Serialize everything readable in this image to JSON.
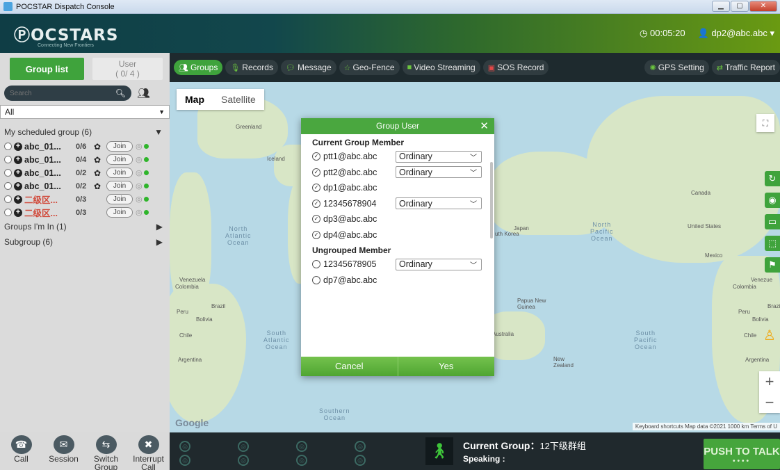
{
  "window": {
    "title": "POCSTAR Dispatch Console"
  },
  "header": {
    "logo_text": "ⓅOCSTARS",
    "logo_tagline": "Connecting New Frontiers",
    "timer": "00:05:20",
    "user": "dp2@abc.abc"
  },
  "sidebar": {
    "tab_group_list": "Group list",
    "tab_user_label": "User",
    "tab_user_count": "( 0/ 4 )",
    "search_placeholder": "Search",
    "filter_value": "All",
    "scheduled_label": "My scheduled group (6)",
    "groups": [
      {
        "name": "abc_01...",
        "count": "0/6",
        "join": "Join",
        "gear": true,
        "red": false
      },
      {
        "name": "abc_01...",
        "count": "0/4",
        "join": "Join",
        "gear": true,
        "red": false
      },
      {
        "name": "abc_01...",
        "count": "0/2",
        "join": "Join",
        "gear": true,
        "red": false
      },
      {
        "name": "abc_01...",
        "count": "0/2",
        "join": "Join",
        "gear": true,
        "red": false
      },
      {
        "name": "二级区...",
        "count": "0/3",
        "join": "Join",
        "gear": false,
        "red": true
      },
      {
        "name": "二级区...",
        "count": "0/3",
        "join": "Join",
        "gear": false,
        "red": true
      }
    ],
    "groups_in_label": "Groups I'm In (1)",
    "subgroup_label": "Subgroup (6)"
  },
  "toolbar": {
    "groups": "Groups",
    "records": "Records",
    "message": "Message",
    "geofence": "Geo-Fence",
    "video": "Video Streaming",
    "sos": "SOS Record",
    "gps": "GPS Setting",
    "traffic": "Traffic Report"
  },
  "map": {
    "type_map": "Map",
    "type_satellite": "Satellite",
    "google": "Google",
    "footer": "Keyboard shortcuts  Map data ©2021  1000 km  Terms of U",
    "labels": {
      "greenland": "Greenland",
      "iceland": "Iceland",
      "north_atlantic": "North\nAtlantic\nOcean",
      "south_atlantic": "South\nAtlantic\nOcean",
      "north_pacific": "North\nPacific\nOcean",
      "south_pacific": "South\nPacific\nOcean",
      "southern_ocean": "Southern\nOcean",
      "canada": "Canada",
      "united_states": "United States",
      "mexico": "Mexico",
      "venezuela": "Venezuela",
      "colombia": "Colombia",
      "peru": "Peru",
      "brazil": "Brazil",
      "bolivia": "Bolivia",
      "chile": "Chile",
      "argentina": "Argentina",
      "australia": "Australia",
      "new_zealand": "New\nZealand",
      "papua": "Papua New\nGuinea",
      "japan": "Japan",
      "south_korea": "uth Korea",
      "venezuela_r": "Venezue",
      "colombia_r": "Colombia",
      "peru_r": "Peru",
      "brazil_r": "Brazi",
      "bolivia_r": "Bolivia",
      "chile_r": "Chile",
      "argentina_r": "Argentina"
    }
  },
  "modal": {
    "title": "Group User",
    "current_section": "Current Group Member",
    "current_members": [
      {
        "user": "ptt1@abc.abc",
        "role": "Ordinary"
      },
      {
        "user": "ptt2@abc.abc",
        "role": "Ordinary"
      },
      {
        "user": "dp1@abc.abc",
        "role": ""
      },
      {
        "user": "12345678904",
        "role": "Ordinary"
      },
      {
        "user": "dp3@abc.abc",
        "role": ""
      },
      {
        "user": "dp4@abc.abc",
        "role": ""
      }
    ],
    "ungrouped_section": "Ungrouped Member",
    "ungrouped_members": [
      {
        "user": "12345678905",
        "role": "Ordinary"
      },
      {
        "user": "dp7@abc.abc",
        "role": ""
      }
    ],
    "cancel": "Cancel",
    "yes": "Yes"
  },
  "bottom": {
    "tools": [
      {
        "label": "Call",
        "icon": "call-icon"
      },
      {
        "label": "Session",
        "icon": "session-icon"
      },
      {
        "label": "Switch Group",
        "icon": "switch-group-icon"
      },
      {
        "label": "Interrupt Call",
        "icon": "interrupt-call-icon"
      }
    ],
    "current_group_label": "Current Group：",
    "current_group_value": "12下级群组",
    "speaking_label": "Speaking :",
    "ptt": "PUSH TO TALK",
    "ptt_dots": "••••"
  },
  "colors": {
    "accent": "#3fa33c",
    "dark": "#1e2a2e"
  }
}
